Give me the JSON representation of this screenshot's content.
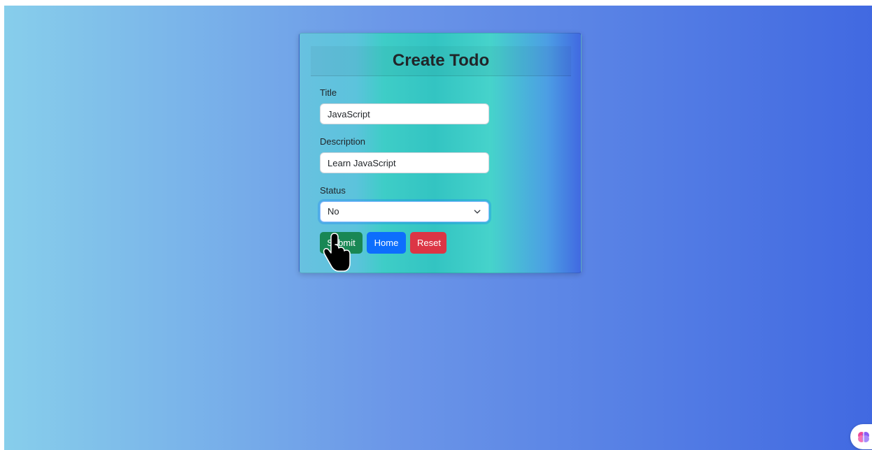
{
  "card": {
    "title": "Create Todo"
  },
  "form": {
    "title_label": "Title",
    "title_value": "JavaScript",
    "description_label": "Description",
    "description_value": "Learn JavaScript",
    "status_label": "Status",
    "status_selected": "No"
  },
  "buttons": {
    "submit": "Submit",
    "home": "Home",
    "reset": "Reset"
  },
  "colors": {
    "submit": "#198754",
    "home": "#0d6efd",
    "reset": "#dc3545",
    "page_gradient_start": "#87ceeb",
    "page_gradient_end": "#4169e1"
  },
  "icons": {
    "select_chevron": "chevron-down-icon",
    "cursor": "hand-pointer-icon",
    "assistant": "brain-icon"
  }
}
